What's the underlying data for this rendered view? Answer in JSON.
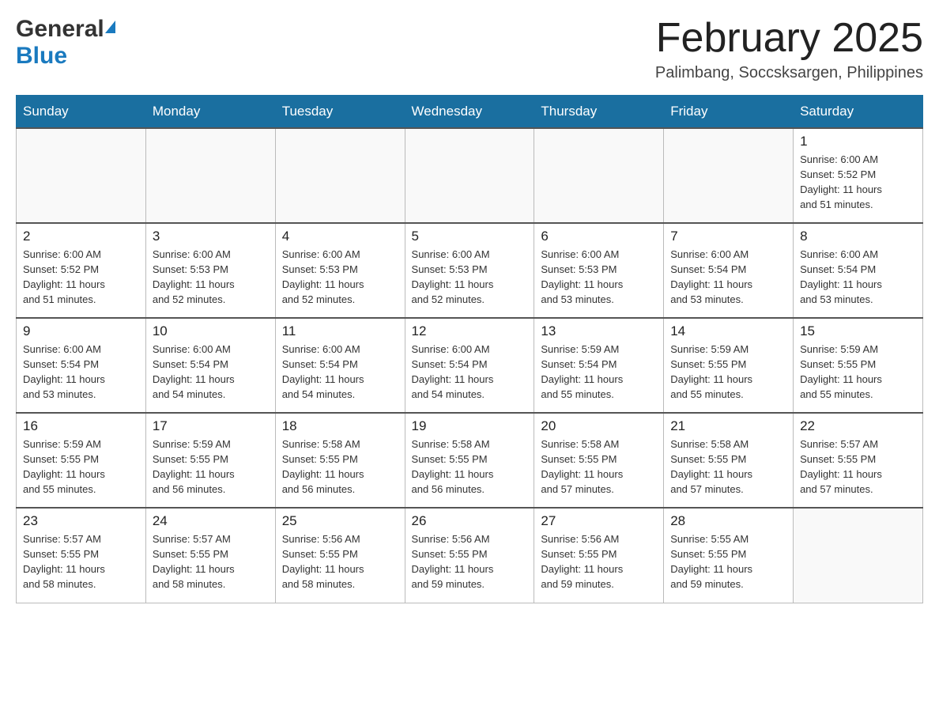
{
  "header": {
    "logo_general": "General",
    "logo_blue": "Blue",
    "month_title": "February 2025",
    "location": "Palimbang, Soccsksargen, Philippines"
  },
  "weekdays": [
    "Sunday",
    "Monday",
    "Tuesday",
    "Wednesday",
    "Thursday",
    "Friday",
    "Saturday"
  ],
  "weeks": [
    [
      {
        "day": "",
        "info": ""
      },
      {
        "day": "",
        "info": ""
      },
      {
        "day": "",
        "info": ""
      },
      {
        "day": "",
        "info": ""
      },
      {
        "day": "",
        "info": ""
      },
      {
        "day": "",
        "info": ""
      },
      {
        "day": "1",
        "info": "Sunrise: 6:00 AM\nSunset: 5:52 PM\nDaylight: 11 hours\nand 51 minutes."
      }
    ],
    [
      {
        "day": "2",
        "info": "Sunrise: 6:00 AM\nSunset: 5:52 PM\nDaylight: 11 hours\nand 51 minutes."
      },
      {
        "day": "3",
        "info": "Sunrise: 6:00 AM\nSunset: 5:53 PM\nDaylight: 11 hours\nand 52 minutes."
      },
      {
        "day": "4",
        "info": "Sunrise: 6:00 AM\nSunset: 5:53 PM\nDaylight: 11 hours\nand 52 minutes."
      },
      {
        "day": "5",
        "info": "Sunrise: 6:00 AM\nSunset: 5:53 PM\nDaylight: 11 hours\nand 52 minutes."
      },
      {
        "day": "6",
        "info": "Sunrise: 6:00 AM\nSunset: 5:53 PM\nDaylight: 11 hours\nand 53 minutes."
      },
      {
        "day": "7",
        "info": "Sunrise: 6:00 AM\nSunset: 5:54 PM\nDaylight: 11 hours\nand 53 minutes."
      },
      {
        "day": "8",
        "info": "Sunrise: 6:00 AM\nSunset: 5:54 PM\nDaylight: 11 hours\nand 53 minutes."
      }
    ],
    [
      {
        "day": "9",
        "info": "Sunrise: 6:00 AM\nSunset: 5:54 PM\nDaylight: 11 hours\nand 53 minutes."
      },
      {
        "day": "10",
        "info": "Sunrise: 6:00 AM\nSunset: 5:54 PM\nDaylight: 11 hours\nand 54 minutes."
      },
      {
        "day": "11",
        "info": "Sunrise: 6:00 AM\nSunset: 5:54 PM\nDaylight: 11 hours\nand 54 minutes."
      },
      {
        "day": "12",
        "info": "Sunrise: 6:00 AM\nSunset: 5:54 PM\nDaylight: 11 hours\nand 54 minutes."
      },
      {
        "day": "13",
        "info": "Sunrise: 5:59 AM\nSunset: 5:54 PM\nDaylight: 11 hours\nand 55 minutes."
      },
      {
        "day": "14",
        "info": "Sunrise: 5:59 AM\nSunset: 5:55 PM\nDaylight: 11 hours\nand 55 minutes."
      },
      {
        "day": "15",
        "info": "Sunrise: 5:59 AM\nSunset: 5:55 PM\nDaylight: 11 hours\nand 55 minutes."
      }
    ],
    [
      {
        "day": "16",
        "info": "Sunrise: 5:59 AM\nSunset: 5:55 PM\nDaylight: 11 hours\nand 55 minutes."
      },
      {
        "day": "17",
        "info": "Sunrise: 5:59 AM\nSunset: 5:55 PM\nDaylight: 11 hours\nand 56 minutes."
      },
      {
        "day": "18",
        "info": "Sunrise: 5:58 AM\nSunset: 5:55 PM\nDaylight: 11 hours\nand 56 minutes."
      },
      {
        "day": "19",
        "info": "Sunrise: 5:58 AM\nSunset: 5:55 PM\nDaylight: 11 hours\nand 56 minutes."
      },
      {
        "day": "20",
        "info": "Sunrise: 5:58 AM\nSunset: 5:55 PM\nDaylight: 11 hours\nand 57 minutes."
      },
      {
        "day": "21",
        "info": "Sunrise: 5:58 AM\nSunset: 5:55 PM\nDaylight: 11 hours\nand 57 minutes."
      },
      {
        "day": "22",
        "info": "Sunrise: 5:57 AM\nSunset: 5:55 PM\nDaylight: 11 hours\nand 57 minutes."
      }
    ],
    [
      {
        "day": "23",
        "info": "Sunrise: 5:57 AM\nSunset: 5:55 PM\nDaylight: 11 hours\nand 58 minutes."
      },
      {
        "day": "24",
        "info": "Sunrise: 5:57 AM\nSunset: 5:55 PM\nDaylight: 11 hours\nand 58 minutes."
      },
      {
        "day": "25",
        "info": "Sunrise: 5:56 AM\nSunset: 5:55 PM\nDaylight: 11 hours\nand 58 minutes."
      },
      {
        "day": "26",
        "info": "Sunrise: 5:56 AM\nSunset: 5:55 PM\nDaylight: 11 hours\nand 59 minutes."
      },
      {
        "day": "27",
        "info": "Sunrise: 5:56 AM\nSunset: 5:55 PM\nDaylight: 11 hours\nand 59 minutes."
      },
      {
        "day": "28",
        "info": "Sunrise: 5:55 AM\nSunset: 5:55 PM\nDaylight: 11 hours\nand 59 minutes."
      },
      {
        "day": "",
        "info": ""
      }
    ]
  ]
}
